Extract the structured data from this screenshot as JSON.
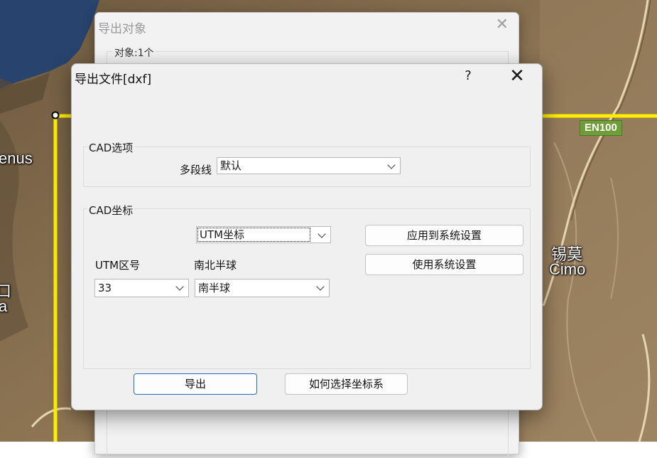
{
  "map": {
    "labels": {
      "place_left_top": "enus",
      "place_left_mid_1": "口",
      "place_left_mid_2": "a",
      "place_right_cn": "锡莫",
      "place_right_en": "Cimo"
    },
    "road_shield": "EN100",
    "colors": {
      "road": "#ffee00",
      "water": "#27436e",
      "terrain": "#8a7352"
    }
  },
  "bg_dialog": {
    "title": "导出对象",
    "close_icon": "✕",
    "count_label": "对象:1个"
  },
  "dialog": {
    "title": "导出文件[dxf]",
    "help_icon": "?",
    "close_icon": "✕",
    "cad_options": {
      "title": "CAD选项",
      "polyline_label": "多段线",
      "polyline_value": "默认"
    },
    "cad_coords": {
      "title": "CAD坐标",
      "coord_system_value": "UTM坐标",
      "apply_button": "应用到系统设置",
      "use_system_button": "使用系统设置",
      "utm_zone_label": "UTM区号",
      "utm_zone_value": "33",
      "hemisphere_label": "南北半球",
      "hemisphere_value": "南半球"
    },
    "export_button": "导出",
    "how_button": "如何选择坐标系"
  }
}
